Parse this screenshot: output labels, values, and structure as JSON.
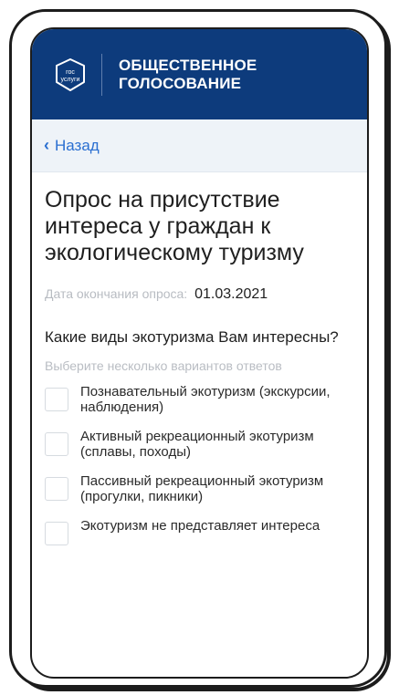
{
  "header": {
    "logo_text_line1": "гос",
    "logo_text_line2": "услуги",
    "brand_line1": "ОБЩЕСТВЕННОЕ",
    "brand_line2": "ГОЛОСОВАНИЕ",
    "background_color": "#0d3b7c"
  },
  "nav": {
    "back_icon": "‹",
    "back_label": "Назад"
  },
  "survey": {
    "title": "Опрос на присутствие интереса у граждан к экологическому туризму",
    "deadline_label": "Дата окончания опроса:",
    "deadline_value": "01.03.2021",
    "question": "Какие виды экотуризма Вам интересны?",
    "hint": "Выберите несколько вариантов ответов",
    "options": [
      {
        "label": "Познавательный экотуризм (экскурсии, наблюдения)",
        "checked": false
      },
      {
        "label": "Активный рекреационный экотуризм (сплавы, походы)",
        "checked": false
      },
      {
        "label": "Пассивный рекреационный экотуризм (прогулки, пикники)",
        "checked": false
      },
      {
        "label": "Экотуризм не представляет интереса",
        "checked": false
      }
    ]
  },
  "colors": {
    "accent": "#2a6fd1",
    "nav_background": "#eef3f8"
  }
}
